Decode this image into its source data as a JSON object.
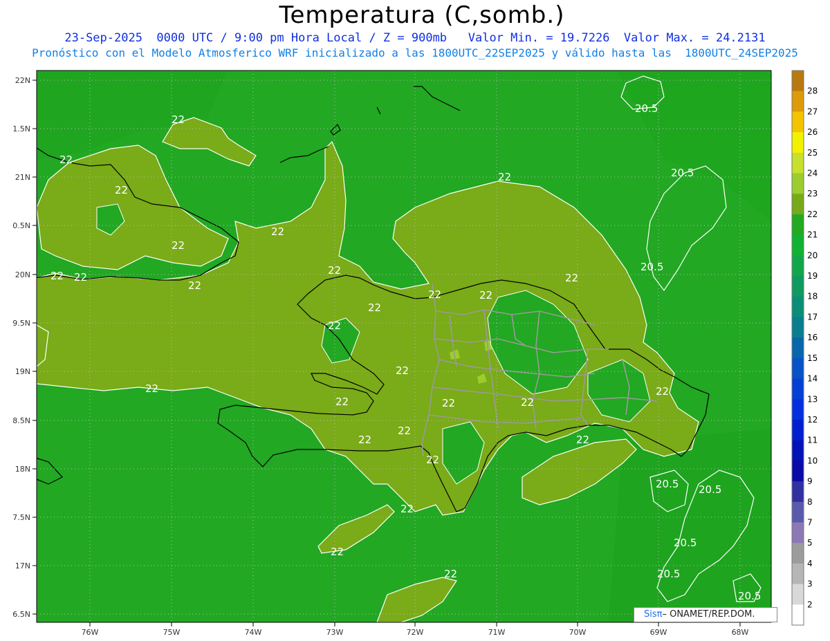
{
  "title": "Temperatura (C,somb.)",
  "subtitle_line1": "23-Sep-2025  0000 UTC / 9:00 pm Hora Local / Z = 900mb   Valor Min. = 19.7226  Valor Max. = 24.2131",
  "subtitle_line2": "Pronóstico con el Modelo Atmosferico WRF inicializado a las 1800UTC_22SEP2025 y válido hasta las  1800UTC_24SEP2025",
  "credit": {
    "logo": "Sisπ",
    "text": "– ONAMET/REP.DOM."
  },
  "axes": {
    "lat_labels": [
      "22N",
      "1.5N",
      "21N",
      "0.5N",
      "20N",
      "9.5N",
      "19N",
      "8.5N",
      "18N",
      "7.5N",
      "17N",
      "6.5N"
    ],
    "lon_labels": [
      "76W",
      "75W",
      "74W",
      "73W",
      "72W",
      "71W",
      "70W",
      "69W",
      "68W"
    ]
  },
  "colorbar": {
    "labels": [
      "28",
      "27",
      "26",
      "25",
      "24",
      "23",
      "22",
      "21",
      "20",
      "19",
      "18",
      "17",
      "16",
      "15",
      "14",
      "13",
      "12",
      "11",
      "10",
      "9",
      "8",
      "7",
      "5",
      "4",
      "3",
      "2"
    ],
    "colors": [
      "#b87a10",
      "#dd9a0a",
      "#f5c400",
      "#f2f200",
      "#c6e02c",
      "#9ccc2e",
      "#77aa18",
      "#22aa22",
      "#11b233",
      "#12a64a",
      "#0f9a60",
      "#0c8e76",
      "#0a7e8e",
      "#0866ab",
      "#0652c6",
      "#0440d6",
      "#0230e0",
      "#0020d0",
      "#0012b8",
      "#0a0aa8",
      "#3030a0",
      "#5a5aac",
      "#8c78b4",
      "#9c9c9c",
      "#b6b6b6",
      "#d8d8d8",
      "#ffffff"
    ]
  },
  "contour_labels": [
    "22",
    "22",
    "22",
    "22",
    "22",
    "22",
    "22",
    "22",
    "22",
    "22",
    "22",
    "22",
    "22",
    "22",
    "22",
    "22",
    "22",
    "22",
    "22",
    "22",
    "22",
    "22",
    "22",
    "22",
    "22",
    "22",
    "20.5",
    "20.5",
    "20.5",
    "20.5",
    "20.5",
    "20.5",
    "20.5",
    "20.5"
  ],
  "field_colors": {
    "base": "#22a822",
    "warm": "#77aa18"
  }
}
